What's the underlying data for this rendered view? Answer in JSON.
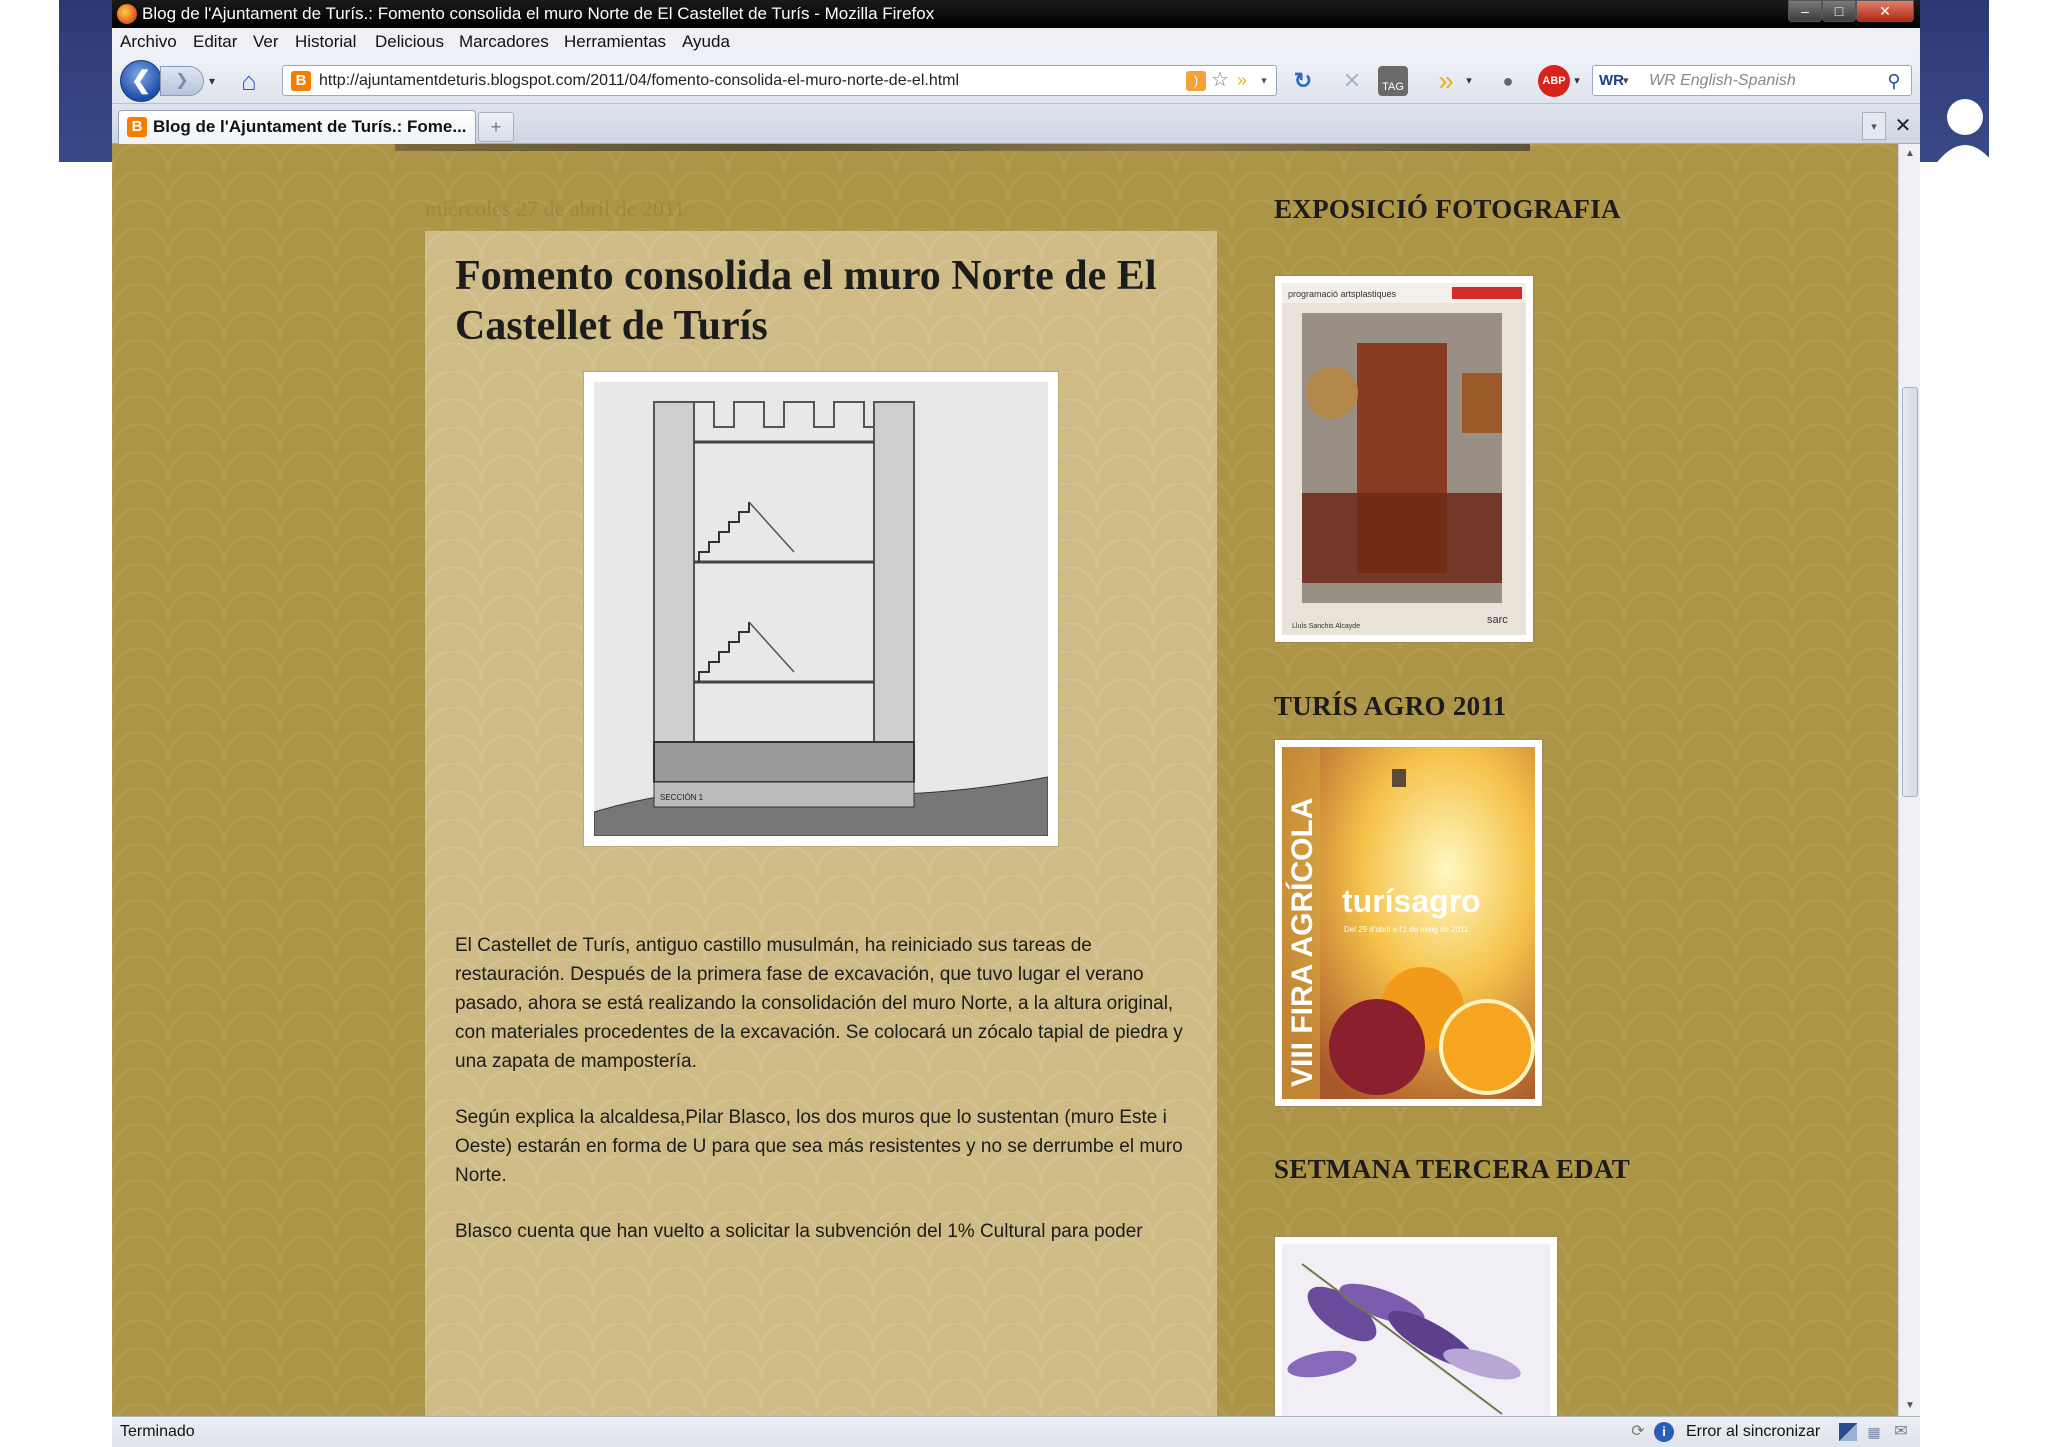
{
  "window": {
    "title": "Blog de l'Ajuntament de Turís.: Fomento consolida el muro Norte de El Castellet de Turís - Mozilla Firefox",
    "controls": {
      "minimize": "–",
      "maximize": "□",
      "close": "✕"
    }
  },
  "menu": {
    "items": [
      "Archivo",
      "Editar",
      "Ver",
      "Historial",
      "Delicious",
      "Marcadores",
      "Herramientas",
      "Ayuda"
    ]
  },
  "nav": {
    "url": "http://ajuntamentdeturis.blogspot.com/2011/04/fomento-consolida-el-muro-norte-de-el.html",
    "search_placeholder": "WR English-Spanish",
    "back_glyph": "❮",
    "forward_glyph": "❯",
    "home_glyph": "⌂",
    "reload_glyph": "↻",
    "stop_glyph": "✕",
    "tag_label": "TAG",
    "abp_label": "ABP",
    "wr_label": "WR",
    "search_glyph": "⚲",
    "star_glyph": "☆",
    "rss_glyph": ")",
    "arrows_glyph": "»",
    "dropdown_glyph": "▾",
    "favicon_letter": "B"
  },
  "tabs": {
    "active_label": "Blog de l'Ajuntament de Turís.: Fome...",
    "new_tab_glyph": "+",
    "list_glyph": "▾",
    "close_glyph": "✕"
  },
  "post": {
    "date": "miércoles 27 de abril de 2011",
    "title": "Fomento consolida el muro Norte de El Castellet de Turís",
    "paragraphs": [
      "El Castellet de Turís, antiguo castillo musulmán, ha reiniciado sus tareas de restauración. Después de la primera fase de excavación, que tuvo lugar el verano pasado, ahora se está realizando la consolidación del muro Norte, a la altura original, con materiales procedentes de la excavación. Se colocará un zócalo tapial de piedra y una zapata de mampostería.",
      "Según explica la alcaldesa,Pilar Blasco, los dos muros que lo sustentan (muro Este i Oeste) estarán en forma de U para que sea más resistentes y no se derrumbe el muro Norte.",
      "Blasco cuenta que han vuelto a solicitar la subvención del 1% Cultural para poder"
    ],
    "drawing_label": "SECCIÓN 1"
  },
  "sidebar": {
    "widgets": [
      {
        "title": "EXPOSICIÓ FOTOGRAFIA",
        "poster_top": "programació artsplastiques",
        "poster_caption": "Lluís Sanchis Alcayde",
        "poster_logo": "sarc"
      },
      {
        "title": "TURÍS AGRO 2011",
        "poster_side": "VIII FIRA AGRÍCOLA",
        "poster_brand": "turísagro",
        "poster_dates": "Del 29 d'abril a l'1 de maig de 2011"
      },
      {
        "title": "SETMANA TERCERA EDAT"
      }
    ]
  },
  "status": {
    "text": "Terminado",
    "sync": "Error al sincronizar",
    "info_glyph": "i"
  },
  "colors": {
    "page_bg": "#ad9547",
    "post_bg": "#cfbb86",
    "text": "#1c1c1c"
  }
}
